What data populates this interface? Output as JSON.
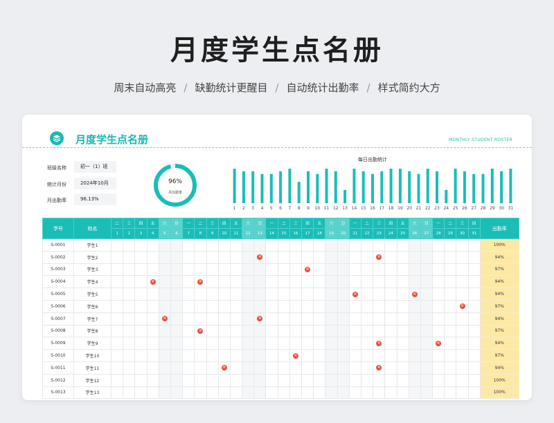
{
  "hero": {
    "title": "月度学生点名册",
    "features": [
      "周末自动高亮",
      "缺勤统计更醒目",
      "自动统计出勤率",
      "样式简约大方"
    ],
    "separator": "/"
  },
  "card": {
    "title": "月度学生点名册",
    "subtitle_en": "MONTHLY STUDENT ROSTER"
  },
  "info": [
    {
      "label": "班级名称",
      "value": "初一（1）班"
    },
    {
      "label": "统计月份",
      "value": "2024年10月"
    },
    {
      "label": "月出勤率",
      "value": "96.13%"
    }
  ],
  "gauge": {
    "value": "96%",
    "fraction": 0.96,
    "label": "月出勤率"
  },
  "colors": {
    "accent": "#1bbdb7",
    "absent": "#e8513f",
    "rate_bg": "#fde9a6",
    "weekend_bg": "#f5f6f8"
  },
  "chart_data": {
    "type": "bar",
    "title": "每日出勤统计",
    "categories": [
      "1",
      "2",
      "3",
      "4",
      "5",
      "6",
      "7",
      "8",
      "9",
      "10",
      "11",
      "12",
      "13",
      "14",
      "15",
      "16",
      "17",
      "18",
      "19",
      "20",
      "21",
      "22",
      "23",
      "24",
      "25",
      "26",
      "27",
      "28",
      "29",
      "30",
      "31"
    ],
    "values": [
      13,
      12,
      12,
      11,
      11,
      12,
      13,
      8,
      12,
      11,
      13,
      12,
      5,
      13,
      12,
      11,
      12,
      13,
      13,
      12,
      11,
      13,
      12,
      5,
      13,
      12,
      11,
      11,
      13,
      12,
      13
    ],
    "ylim": [
      0,
      13
    ]
  },
  "table": {
    "headers": {
      "id": "学号",
      "name": "姓名",
      "rate": "出勤率"
    },
    "weekdays": [
      "二",
      "三",
      "四",
      "五",
      "六",
      "日",
      "一",
      "二",
      "三",
      "四",
      "五",
      "六",
      "日",
      "一",
      "二",
      "三",
      "四",
      "五",
      "六",
      "日",
      "一",
      "二",
      "三",
      "四",
      "五",
      "六",
      "日",
      "一",
      "二",
      "三",
      "四"
    ],
    "dates": [
      "1",
      "2",
      "3",
      "4",
      "5",
      "6",
      "7",
      "8",
      "9",
      "10",
      "11",
      "12",
      "13",
      "14",
      "15",
      "16",
      "17",
      "18",
      "19",
      "20",
      "21",
      "22",
      "23",
      "24",
      "25",
      "26",
      "27",
      "28",
      "29",
      "30",
      "31"
    ],
    "weekend_days": [
      5,
      6,
      12,
      13,
      19,
      20,
      26,
      27
    ],
    "absent_mark": "✕",
    "rows": [
      {
        "id": "S-0001",
        "name": "学生1",
        "rate": "100%",
        "absent": []
      },
      {
        "id": "S-0002",
        "name": "学生2",
        "rate": "94%",
        "absent": [
          13,
          23
        ]
      },
      {
        "id": "S-0003",
        "name": "学生3",
        "rate": "97%",
        "absent": [
          17
        ]
      },
      {
        "id": "S-0004",
        "name": "学生4",
        "rate": "94%",
        "absent": [
          4,
          8
        ]
      },
      {
        "id": "S-0005",
        "name": "学生5",
        "rate": "94%",
        "absent": [
          21,
          26
        ]
      },
      {
        "id": "S-0006",
        "name": "学生6",
        "rate": "97%",
        "absent": [
          30
        ]
      },
      {
        "id": "S-0007",
        "name": "学生7",
        "rate": "94%",
        "absent": [
          5,
          13
        ]
      },
      {
        "id": "S-0008",
        "name": "学生8",
        "rate": "97%",
        "absent": [
          8
        ]
      },
      {
        "id": "S-0009",
        "name": "学生9",
        "rate": "94%",
        "absent": [
          23,
          28
        ]
      },
      {
        "id": "S-0010",
        "name": "学生10",
        "rate": "97%",
        "absent": [
          16
        ]
      },
      {
        "id": "S-0011",
        "name": "学生11",
        "rate": "94%",
        "absent": [
          10,
          23
        ]
      },
      {
        "id": "S-0012",
        "name": "学生12",
        "rate": "100%",
        "absent": []
      },
      {
        "id": "S-0013",
        "name": "学生13",
        "rate": "100%",
        "absent": []
      }
    ]
  }
}
